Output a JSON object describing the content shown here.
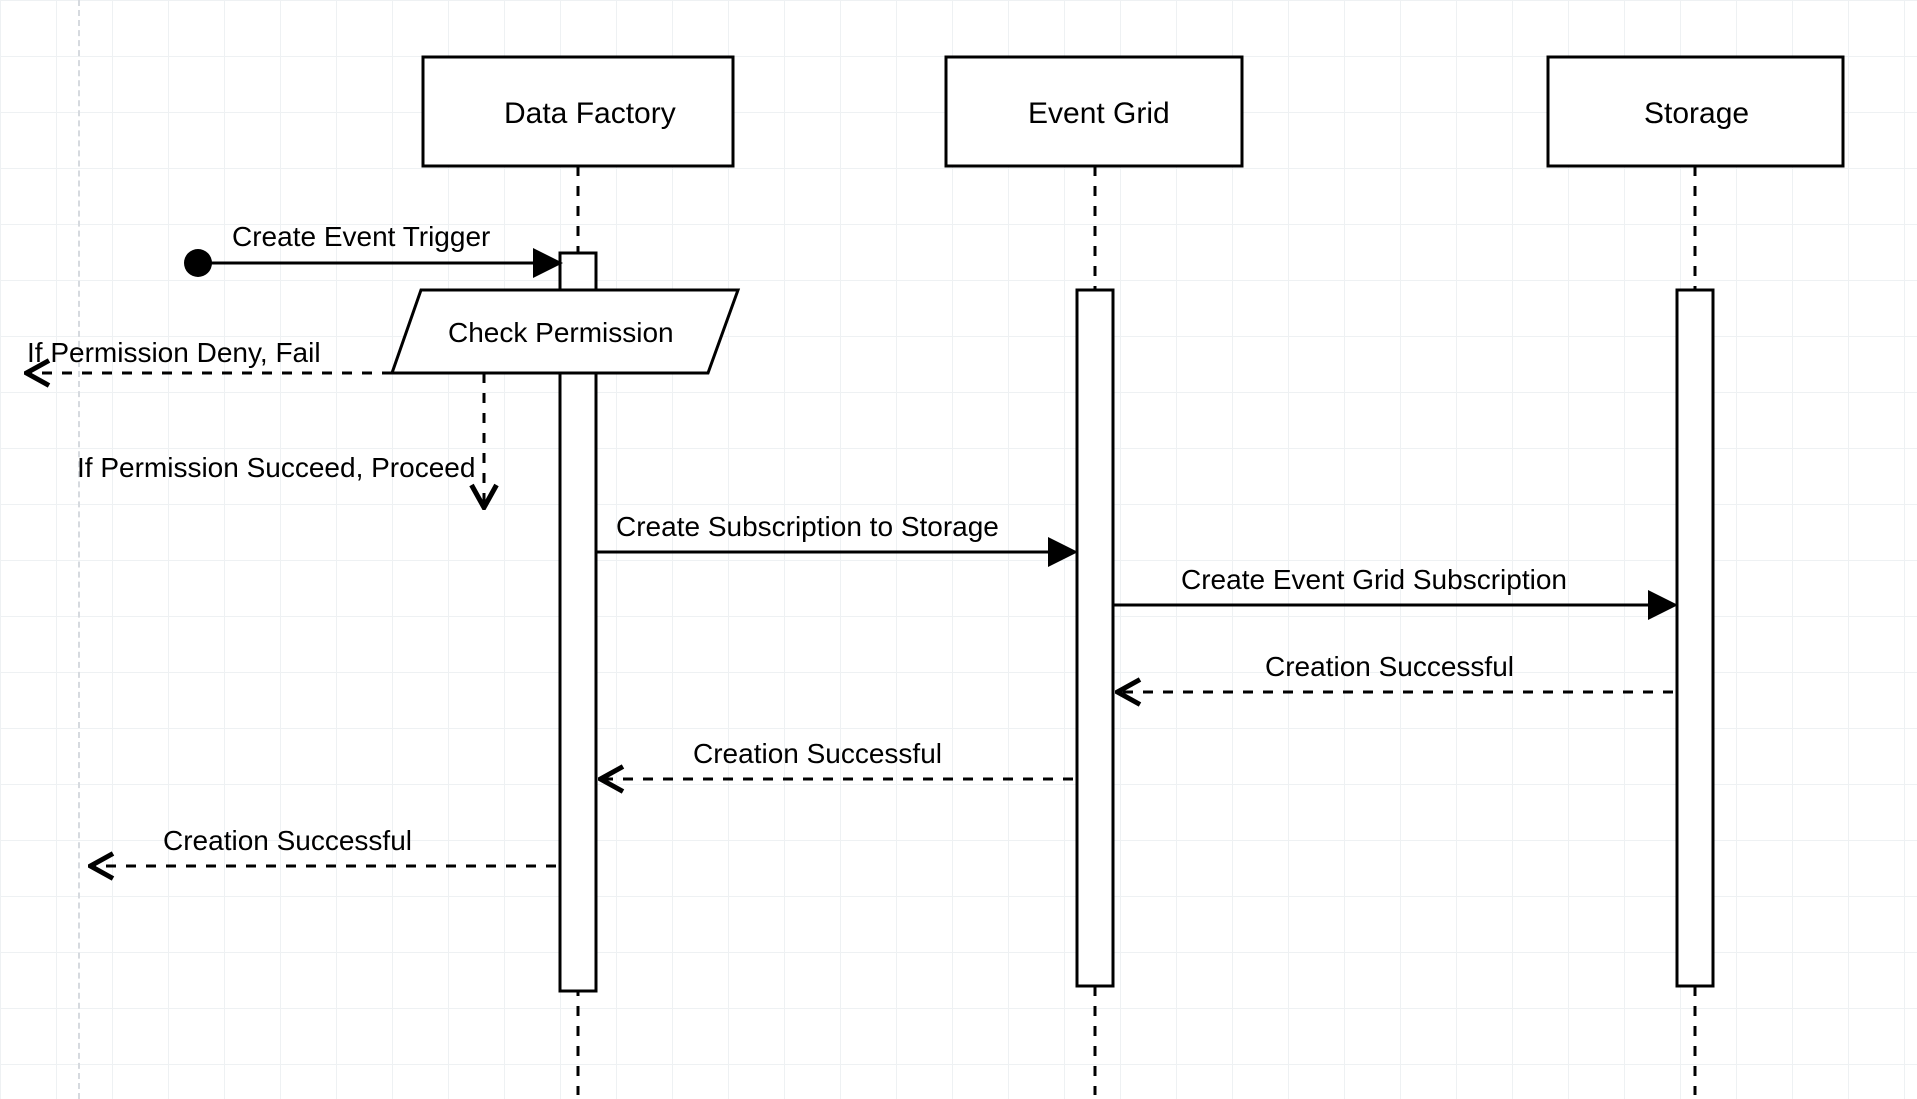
{
  "diagram": {
    "participants": {
      "data_factory": "Data Factory",
      "event_grid": "Event Grid",
      "storage": "Storage"
    },
    "process": {
      "check_permission": "Check Permission"
    },
    "messages": {
      "create_event_trigger": "Create Event Trigger",
      "perm_deny_fail": "If Permission Deny, Fail",
      "perm_succeed_proceed": "If Permission Succeed, Proceed",
      "create_subscription_to_storage": "Create Subscription to Storage",
      "create_event_grid_subscription": "Create Event Grid Subscription",
      "creation_successful_sg_to_eg": "Creation Successful",
      "creation_successful_eg_to_df": "Creation Successful",
      "creation_successful_df_to_caller": "Creation Successful"
    }
  }
}
